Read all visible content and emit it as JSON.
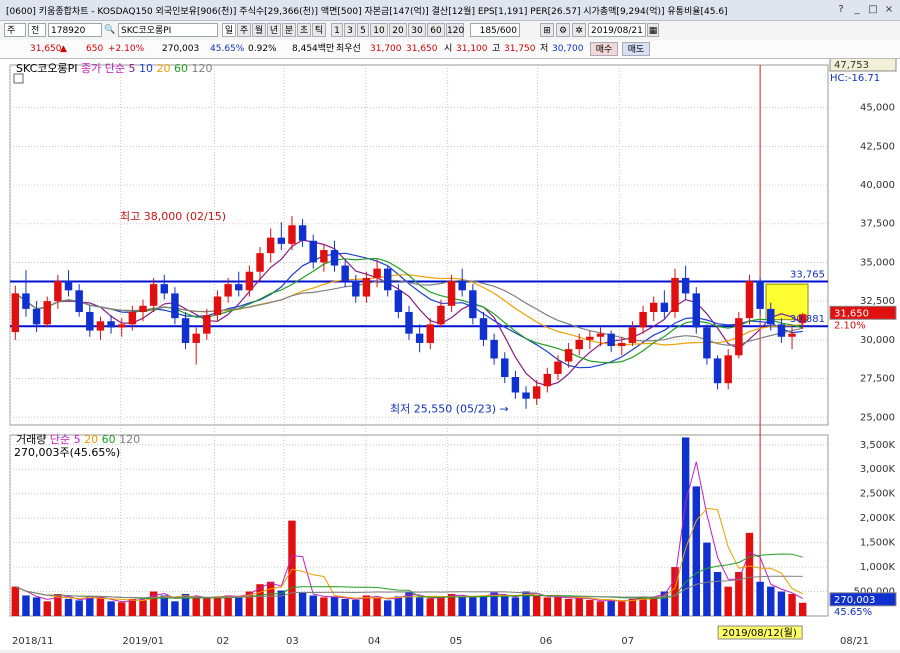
{
  "window": {
    "title": "[0600] 키움종합차트 - KOSDAQ150 외국인보유[906(천)] 주식수[29,366(천)] 액면[500] 자본금[147(억)] 결산[12월] EPS[1,191] PER[26.57] 시가총액[9,294(억)] 유통비율[45.6]",
    "buttons": [
      "?",
      "_",
      "□",
      "×"
    ]
  },
  "toolbar": {
    "type_label": "주",
    "mode_label": "전",
    "code": "178920",
    "stock_name": "SKC코오롱PI",
    "period_buttons": [
      "일",
      "주",
      "월",
      "년",
      "분",
      "초",
      "틱"
    ],
    "minute_buttons": [
      "1",
      "3",
      "5",
      "10",
      "20",
      "30",
      "60",
      "120"
    ],
    "count": "185/600",
    "date": "2019/08/21"
  },
  "quote": {
    "price": "31,650",
    "change": "650",
    "change_pct": "+2.10%",
    "volume": "270,003",
    "turnover_pct": "45.65%",
    "vol_change": "0.92%",
    "amount": "8,454백만",
    "best_label": "최우선",
    "best_ask": "31,700",
    "best_bid": "31,650",
    "open_label": "시",
    "open": "31,100",
    "high_label": "고",
    "high": "31,750",
    "low_label": "저",
    "low": "30,700",
    "buy_label": "매수",
    "sell_label": "매도"
  },
  "price_panel": {
    "legend_name": "SKC코오롱PI",
    "legend_close": "종가",
    "legend_ma_label": "단순",
    "ma_periods": [
      "5",
      "10",
      "20",
      "60",
      "120"
    ],
    "ma_colors": [
      "#8b1c8b",
      "#2040d0",
      "#f0a000",
      "#20a020",
      "#808080"
    ],
    "high_note": "최고 38,000 (02/15)",
    "low_note": "최저 25,550 (05/23)",
    "top_label": "47,753",
    "hc_label": "HC:-16.71",
    "line_upper": "33,765",
    "line_lower": "30,881",
    "current_price": "31,650",
    "current_pct": "2.10%",
    "y_ticks": [
      "45,000",
      "42,500",
      "40,000",
      "37,500",
      "35,000",
      "32,500",
      "30,000",
      "27,500",
      "25,000"
    ]
  },
  "volume_panel": {
    "legend_name": "거래량",
    "legend_ma_label": "단순",
    "ma_periods": [
      "5",
      "20",
      "60",
      "120"
    ],
    "ma_colors": [
      "#c020c0",
      "#f0a000",
      "#20a020",
      "#808080"
    ],
    "current_vol": "270,003주(45.65%)",
    "current_vol_label": "270,003",
    "current_vol_pct": "45.65%",
    "y_ticks": [
      "3,500K",
      "3,000K",
      "2,500K",
      "2,000K",
      "1,500K",
      "1,000K",
      "500,000"
    ]
  },
  "x_axis": {
    "labels": [
      "2018/11",
      "2019/01",
      "02",
      "03",
      "04",
      "05",
      "06",
      "07",
      "08/21"
    ],
    "cursor_label": "2019/08/12(월)"
  },
  "chart_data": {
    "type": "candlestick",
    "ylim": [
      24500,
      47753
    ],
    "volume_ylim": [
      0,
      3700000
    ],
    "candles": [
      [
        30500,
        33500,
        30000,
        33000
      ],
      [
        33000,
        34500,
        31500,
        32000
      ],
      [
        32000,
        32500,
        30500,
        31000
      ],
      [
        31000,
        32800,
        30800,
        32500
      ],
      [
        32500,
        34200,
        32000,
        33800
      ],
      [
        33800,
        34500,
        32800,
        33200
      ],
      [
        33200,
        33600,
        31500,
        31800
      ],
      [
        31800,
        32200,
        30200,
        30600
      ],
      [
        30600,
        31500,
        30000,
        31200
      ],
      [
        31200,
        31600,
        30400,
        30800
      ],
      [
        30800,
        31400,
        30200,
        31000
      ],
      [
        31000,
        32200,
        30600,
        31800
      ],
      [
        31800,
        32600,
        31200,
        32200
      ],
      [
        32200,
        34000,
        31800,
        33600
      ],
      [
        33600,
        34200,
        32600,
        33000
      ],
      [
        33000,
        33400,
        31000,
        31400
      ],
      [
        31400,
        31800,
        29400,
        29800
      ],
      [
        29800,
        30800,
        28400,
        30400
      ],
      [
        30400,
        32000,
        30000,
        31600
      ],
      [
        31600,
        33200,
        31200,
        32800
      ],
      [
        32800,
        34000,
        32400,
        33600
      ],
      [
        33600,
        34400,
        32800,
        33200
      ],
      [
        33200,
        34800,
        32800,
        34400
      ],
      [
        34400,
        36000,
        33800,
        35600
      ],
      [
        35600,
        37200,
        35000,
        36600
      ],
      [
        36600,
        37600,
        35800,
        36200
      ],
      [
        36200,
        38000,
        35800,
        37400
      ],
      [
        37400,
        37800,
        36000,
        36400
      ],
      [
        36400,
        36800,
        34600,
        35000
      ],
      [
        35000,
        36200,
        34400,
        35800
      ],
      [
        35800,
        36400,
        34400,
        34800
      ],
      [
        34800,
        35200,
        33400,
        33800
      ],
      [
        33800,
        34200,
        32400,
        32800
      ],
      [
        32800,
        34400,
        32400,
        34000
      ],
      [
        34000,
        35200,
        33400,
        34600
      ],
      [
        34600,
        34800,
        32800,
        33200
      ],
      [
        33200,
        33600,
        31400,
        31800
      ],
      [
        31800,
        32200,
        30000,
        30400
      ],
      [
        30400,
        31000,
        29200,
        29800
      ],
      [
        29800,
        31400,
        29400,
        31000
      ],
      [
        31000,
        32600,
        30800,
        32200
      ],
      [
        32200,
        34200,
        31800,
        33800
      ],
      [
        33800,
        34600,
        32800,
        33200
      ],
      [
        33200,
        33600,
        31000,
        31400
      ],
      [
        31400,
        31800,
        29600,
        30000
      ],
      [
        30000,
        30400,
        28400,
        28800
      ],
      [
        28800,
        29200,
        27200,
        27600
      ],
      [
        27600,
        28000,
        26200,
        26600
      ],
      [
        26600,
        27000,
        25550,
        26200
      ],
      [
        26200,
        27400,
        25800,
        27000
      ],
      [
        27000,
        28200,
        26600,
        27800
      ],
      [
        27800,
        29000,
        27400,
        28600
      ],
      [
        28600,
        29800,
        28200,
        29400
      ],
      [
        29400,
        30400,
        29000,
        30000
      ],
      [
        30000,
        30600,
        29400,
        30200
      ],
      [
        30200,
        30800,
        29600,
        30400
      ],
      [
        30400,
        30600,
        29200,
        29600
      ],
      [
        29600,
        30200,
        29000,
        29800
      ],
      [
        29800,
        31200,
        29600,
        30800
      ],
      [
        30800,
        32200,
        30400,
        31800
      ],
      [
        31800,
        32800,
        31200,
        32400
      ],
      [
        32400,
        33200,
        31400,
        31800
      ],
      [
        31800,
        34600,
        31400,
        34000
      ],
      [
        34000,
        34800,
        32600,
        33000
      ],
      [
        33000,
        33400,
        30400,
        30800
      ],
      [
        30800,
        31000,
        28400,
        28800
      ],
      [
        28800,
        29000,
        26800,
        27200
      ],
      [
        27200,
        29400,
        26800,
        29000
      ],
      [
        29000,
        31800,
        28800,
        31400
      ],
      [
        31400,
        34200,
        31000,
        33800
      ],
      [
        33800,
        34000,
        31600,
        32000
      ],
      [
        32000,
        32400,
        30600,
        31000
      ],
      [
        31000,
        31400,
        29800,
        30200
      ],
      [
        30200,
        30800,
        29400,
        30400
      ],
      [
        31100,
        31750,
        30700,
        31650
      ]
    ],
    "volumes": [
      600000,
      420000,
      380000,
      300000,
      450000,
      350000,
      320000,
      400000,
      380000,
      300000,
      280000,
      350000,
      330000,
      500000,
      420000,
      300000,
      450000,
      380000,
      360000,
      400000,
      420000,
      380000,
      500000,
      650000,
      700000,
      520000,
      1950000,
      480000,
      420000,
      380000,
      400000,
      350000,
      330000,
      420000,
      380000,
      320000,
      400000,
      480000,
      380000,
      360000,
      380000,
      450000,
      400000,
      380000,
      420000,
      480000,
      400000,
      380000,
      500000,
      420000,
      380000,
      400000,
      350000,
      380000,
      330000,
      300000,
      320000,
      300000,
      350000,
      400000,
      380000,
      500000,
      1000000,
      3650000,
      2650000,
      1500000,
      900000,
      600000,
      900000,
      1700000,
      700000,
      600000,
      500000,
      450000,
      270003
    ]
  }
}
